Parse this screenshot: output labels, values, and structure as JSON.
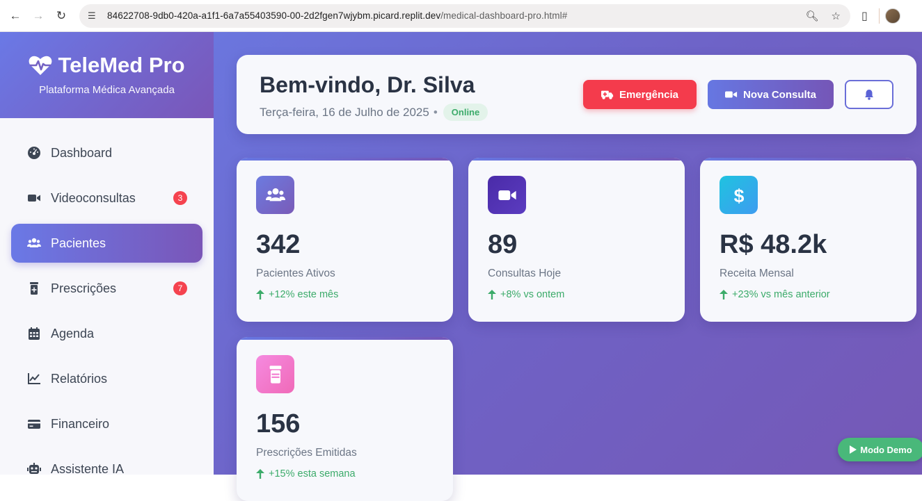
{
  "browser": {
    "url_host": "84622708-9db0-420a-a1f1-6a7a55403590-00-2d2fgen7wjybm.picard.replit.dev",
    "url_path": "/medical-dashboard-pro.html#"
  },
  "sidebar": {
    "brand": "TeleMed Pro",
    "tagline": "Plataforma Médica Avançada",
    "items": [
      {
        "label": "Dashboard",
        "icon": "dashboard-icon"
      },
      {
        "label": "Videoconsultas",
        "icon": "video-icon",
        "badge": "3"
      },
      {
        "label": "Pacientes",
        "icon": "users-icon",
        "active": true
      },
      {
        "label": "Prescrições",
        "icon": "prescription-icon",
        "badge": "7"
      },
      {
        "label": "Agenda",
        "icon": "calendar-icon"
      },
      {
        "label": "Relatórios",
        "icon": "chart-line-icon"
      },
      {
        "label": "Financeiro",
        "icon": "credit-card-icon"
      },
      {
        "label": "Assistente IA",
        "icon": "robot-icon"
      }
    ]
  },
  "header": {
    "welcome": "Bem-vindo, Dr. Silva",
    "date": "Terça-feira, 16 de Julho de 2025",
    "status": "Online",
    "emergency_label": "Emergência",
    "new_consult_label": "Nova Consulta"
  },
  "stats": [
    {
      "value": "342",
      "label": "Pacientes Ativos",
      "trend": "+12% este mês",
      "icon": "users-icon",
      "color": "#6b6fd8"
    },
    {
      "value": "89",
      "label": "Consultas Hoje",
      "trend": "+8% vs ontem",
      "icon": "video-icon",
      "color": "#5532b0"
    },
    {
      "value": "R$ 48.2k",
      "label": "Receita Mensal",
      "trend": "+23% vs mês anterior",
      "icon": "dollar-icon",
      "color": "#2bb6e6"
    },
    {
      "value": "156",
      "label": "Prescrições Emitidas",
      "trend": "+15% esta semana",
      "icon": "pill-bottle-icon",
      "color": "#f07fd8"
    }
  ],
  "demo_label": "Modo Demo",
  "colors": {
    "accent": "#6a79e6",
    "emergency": "#f43b4c",
    "success": "#3cab6a"
  }
}
